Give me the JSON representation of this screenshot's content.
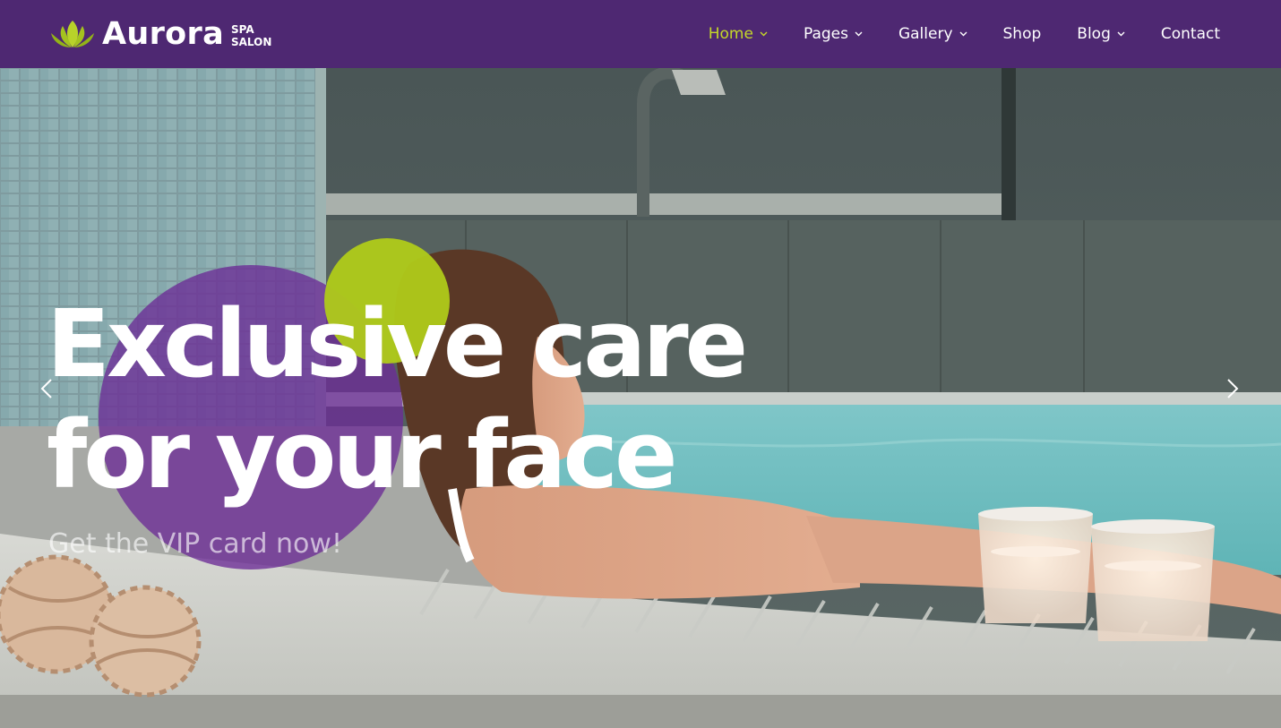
{
  "brand": {
    "name": "Aurora",
    "tagline_line1": "SPA",
    "tagline_line2": "SALON",
    "logo_icon": "lotus-icon"
  },
  "nav": {
    "items": [
      {
        "label": "Home",
        "active": true,
        "has_dropdown": true
      },
      {
        "label": "Pages",
        "active": false,
        "has_dropdown": true
      },
      {
        "label": "Gallery",
        "active": false,
        "has_dropdown": true
      },
      {
        "label": "Shop",
        "active": false,
        "has_dropdown": false
      },
      {
        "label": "Blog",
        "active": false,
        "has_dropdown": true
      },
      {
        "label": "Contact",
        "active": false,
        "has_dropdown": false
      }
    ]
  },
  "hero": {
    "headline_line1": "Exclusive care",
    "headline_line2": "for your face",
    "subheadline": "Get the VIP card now!",
    "prev_icon": "chevron-left-icon",
    "next_icon": "chevron-right-icon"
  },
  "colors": {
    "header_bg": "#4e2872",
    "accent_green": "#c5d828",
    "circle_purple": "#6c2c96",
    "circle_green": "#b0cc1a",
    "text_light": "#ffffff"
  }
}
